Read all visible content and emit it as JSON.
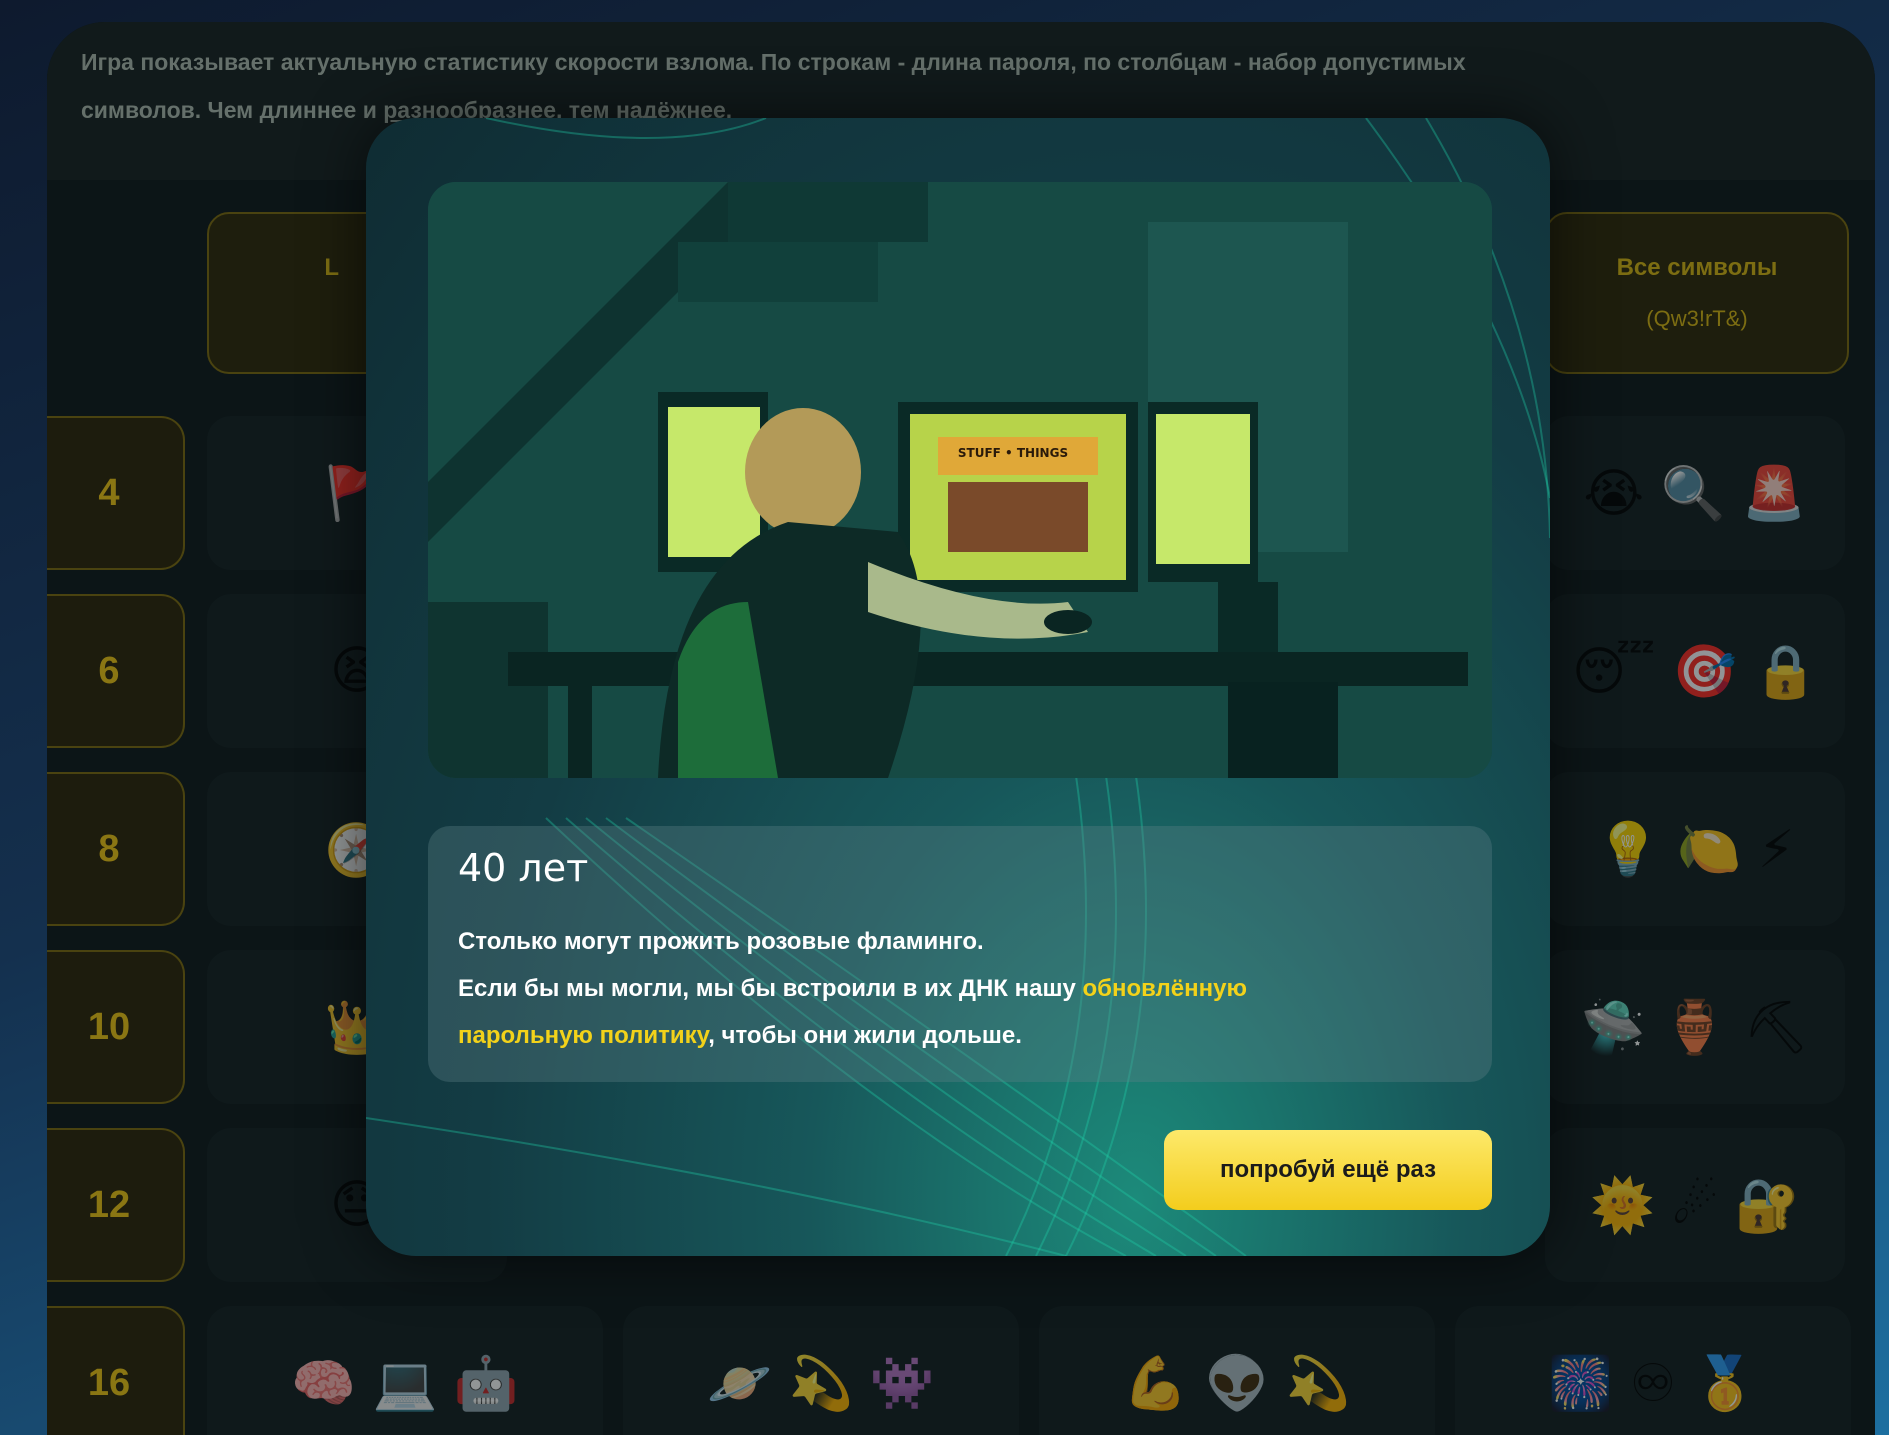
{
  "intro": {
    "line1": "Игра показывает актуальную статистику скорости взлома. По строкам - длина пароля, по столбцам - набор допустимых",
    "line2_plain": "символов. Чем длиннее и ",
    "line2_link": "разнообразнее, тем надёжнее."
  },
  "table": {
    "col_first_partial": "L",
    "col_last_title": "Все символы",
    "col_last_example": "(Qw3!rT&)",
    "rows": [
      {
        "label": "4",
        "left": "🚩",
        "right": "😭 🔍 🚨"
      },
      {
        "label": "6",
        "left": "😫",
        "right": "😴 🎯 🔒"
      },
      {
        "label": "8",
        "left": "🧭",
        "right": "💡 🍋 ⚡"
      },
      {
        "label": "10",
        "left": "👑",
        "right": "🛸 🏺 ⛏"
      },
      {
        "label": "12",
        "left": "😓",
        "right": "🌞 ☄ 🔐"
      }
    ],
    "last_row": {
      "label": "16",
      "c1": "🧠 💻 🤖",
      "c2": "🪐 💫 👾",
      "c3": "💪 👽 💫",
      "c4": "🎆 ♾ 🥇"
    }
  },
  "modal": {
    "title": "40 лет",
    "line1": "Столько могут прожить розовые фламинго.",
    "line2_plain": "Если бы мы могли, мы бы встроили в их ДНК нашу ",
    "line2_hl": "обновлённую",
    "line3_hl": "парольную политику",
    "line3_plain": ", чтобы они жили дольше.",
    "illustration_sign": "STUFF • THINGS",
    "button_label": "попробуй ещё раз"
  },
  "colors": {
    "accent_yellow": "#f2d21a",
    "button_bg": "#f7d83a",
    "modal_bg": "#133c44"
  }
}
